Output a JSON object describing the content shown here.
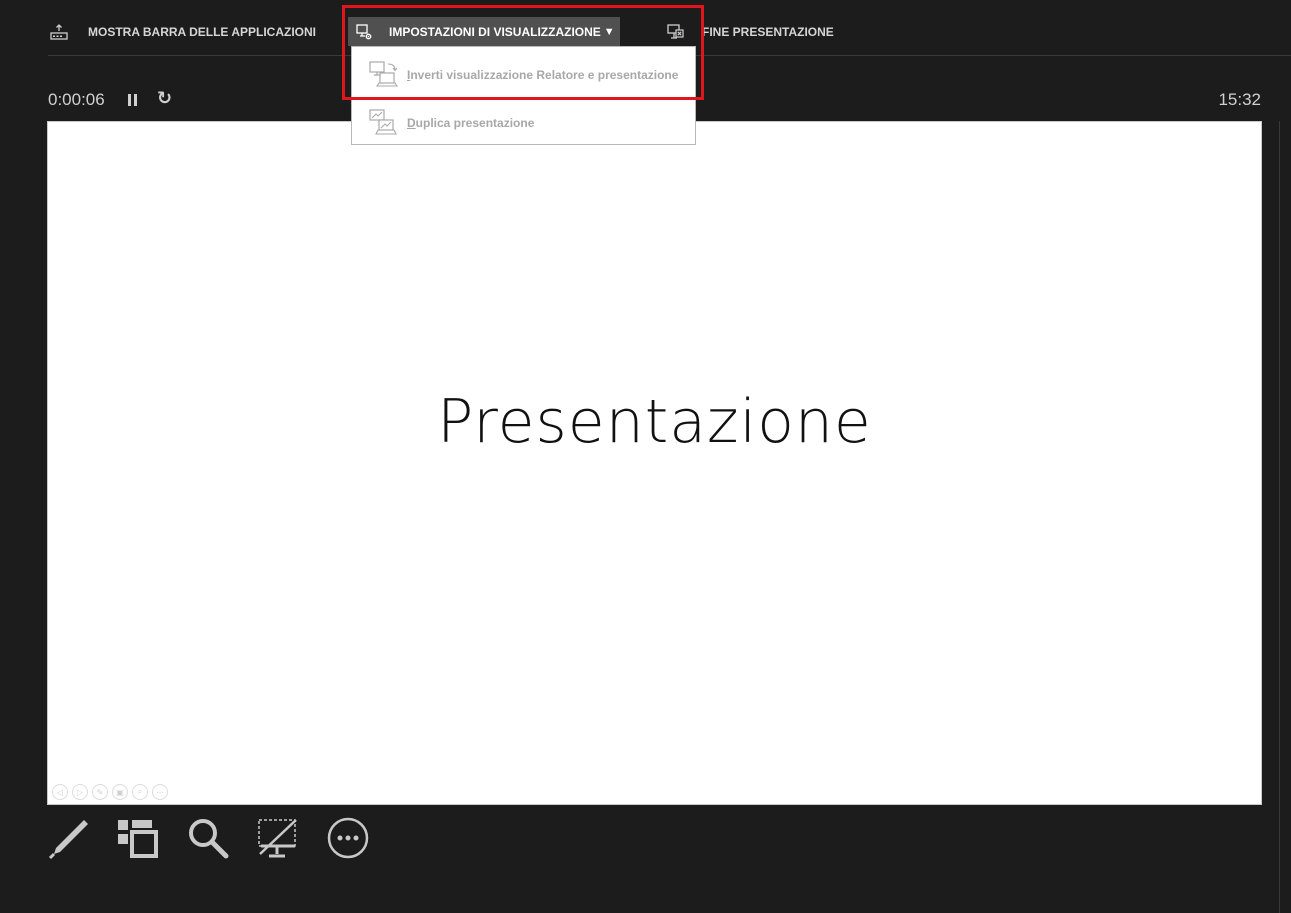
{
  "toolbar": {
    "show_taskbar_label": "MOSTRA BARRA DELLE APPLICAZIONI",
    "display_settings_label": "IMPOSTAZIONI DI VISUALIZZAZIONE",
    "display_settings_caret": "▼",
    "end_show_label": "FINE PRESENTAZIONE"
  },
  "dropdown": {
    "items": [
      {
        "label": "Inverti visualizzazione Relatore e presentazione",
        "icon": "swap-displays-icon"
      },
      {
        "label": "Duplica presentazione",
        "icon": "duplicate-display-icon"
      }
    ]
  },
  "timer": {
    "elapsed": "0:00:06",
    "pause_icon": "pause-icon",
    "reset_icon": "↻"
  },
  "clock": "15:32",
  "slide": {
    "title": "Presentazione",
    "mini_controls": [
      "◁",
      "▷",
      "✎",
      "▣",
      "⌕",
      "⋯"
    ]
  },
  "bottom_tools": [
    {
      "name": "pen-tool",
      "icon": "pen-icon"
    },
    {
      "name": "see-all-slides",
      "icon": "slides-grid-icon"
    },
    {
      "name": "zoom",
      "icon": "magnifier-icon"
    },
    {
      "name": "black-screen",
      "icon": "black-screen-icon"
    },
    {
      "name": "more-options",
      "icon": "more-icon"
    }
  ],
  "colors": {
    "background": "#1c1c1c",
    "highlight": "#e0161d",
    "active_tab": "#505050",
    "disabled_text": "#a8a8a8"
  }
}
